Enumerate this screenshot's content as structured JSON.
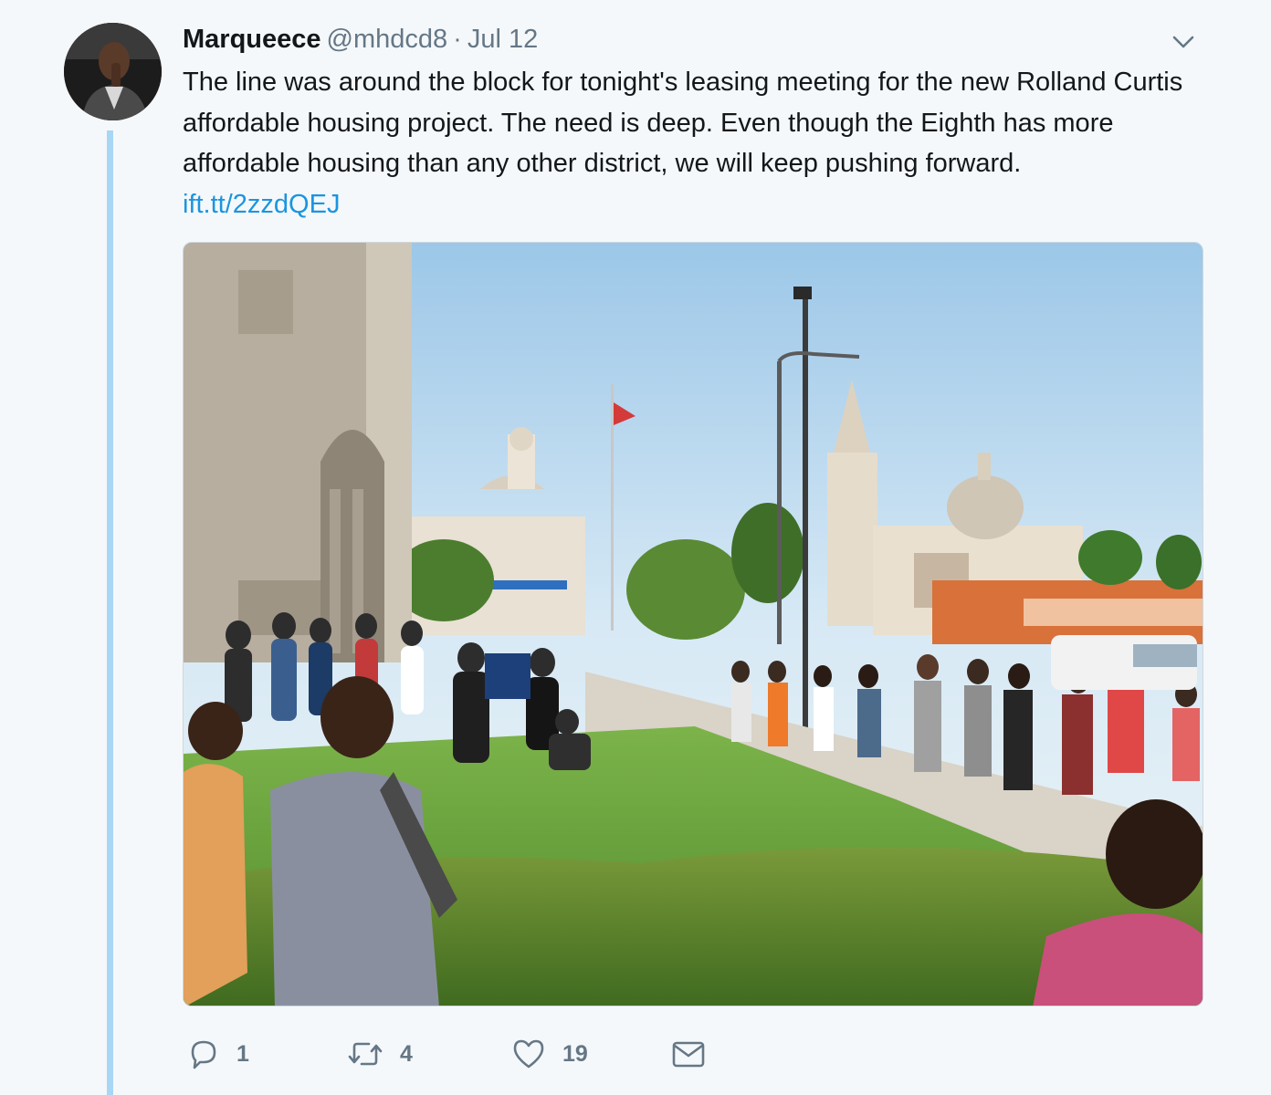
{
  "tweet": {
    "author_name": "Marqueece",
    "author_handle": "@mhdcd8",
    "separator": "·",
    "date": "Jul 12",
    "text": "The line was around the block for tonight's leasing meeting for the new Rolland Curtis affordable housing project. The need is deep. Even though the Eighth has more affordable housing than any other district, we will keep pushing forward.",
    "link_text": "ift.tt/2zzdQEJ",
    "media_icon": "photo-crowd-outside-church",
    "actions": {
      "reply": {
        "icon": "reply-icon",
        "count": "1"
      },
      "retweet": {
        "icon": "retweet-icon",
        "count": "4"
      },
      "like": {
        "icon": "heart-icon",
        "count": "19"
      },
      "dm": {
        "icon": "envelope-icon"
      }
    }
  },
  "colors": {
    "background": "#f5f8fa",
    "link": "#1b95e0",
    "secondary_text": "#657786",
    "thread_line": "#a8d6f5"
  }
}
